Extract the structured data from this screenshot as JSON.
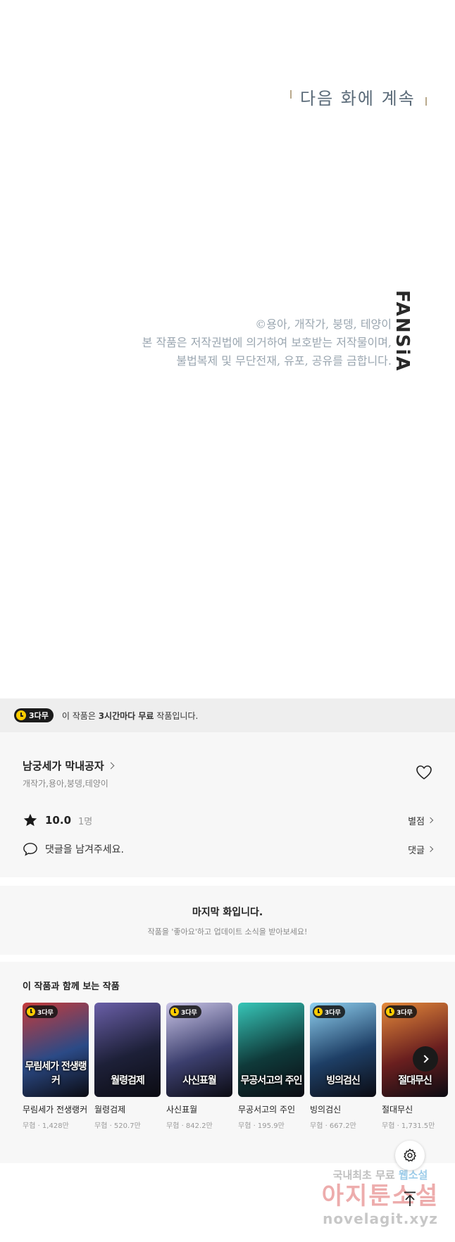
{
  "episode": {
    "to_be_continued": "다음 화에 계속",
    "copyright_lines": [
      "©용아, 개작가, 붕뎅, 테양이",
      "본 작품은 저작권법에 의거하여 보호받는 저작물이며,",
      "불법복제 및 무단전재, 유포, 공유를 금합니다."
    ],
    "logo": "FANSiA"
  },
  "free_banner": {
    "badge": "3다무",
    "message_prefix": "이 작품은 ",
    "message_bold": "3시간마다 무료",
    "message_suffix": " 작품입니다."
  },
  "work": {
    "title": "남궁세가 막내공자",
    "authors": "개작가,용아,붕뎅,테양이",
    "rating": "10.0",
    "rating_count": "1명",
    "rating_link": "별점",
    "comment_placeholder": "댓글을 남겨주세요.",
    "comment_link": "댓글"
  },
  "last_episode": {
    "title": "마지막 화입니다.",
    "subtitle": "작품을 '좋아요'하고 업데이트 소식을 받아보세요!"
  },
  "recommendations": {
    "title": "이 작품과 함께 보는 작품",
    "items": [
      {
        "badge": "3다무",
        "cover_text": "무림세가 전생랭커",
        "name": "무림세가 전생랭커",
        "meta": "무협 · 1,428만",
        "color1": "#2b4a86",
        "color2": "#c53a3a"
      },
      {
        "badge": "",
        "cover_text": "월령검제",
        "name": "월령검제",
        "meta": "무협 · 520.7만",
        "color1": "#1d2038",
        "color2": "#6a5fa8"
      },
      {
        "badge": "3다무",
        "cover_text": "사신표월",
        "name": "사신표월",
        "meta": "무협 · 842.2만",
        "color1": "#3c3f6e",
        "color2": "#c9c4e6"
      },
      {
        "badge": "",
        "cover_text": "무공서고의 주인",
        "name": "무공서고의 주인",
        "meta": "무협 · 195.9만",
        "color1": "#0f3a3a",
        "color2": "#37c6b8"
      },
      {
        "badge": "3다무",
        "cover_text": "빙의검신",
        "name": "빙의검신",
        "meta": "무협 · 667.2만",
        "color1": "#1e3f66",
        "color2": "#8fd0f0"
      },
      {
        "badge": "3다무",
        "cover_text": "절대무신",
        "name": "절대무신",
        "meta": "무협 · 1,731.5만",
        "color1": "#6a1f1f",
        "color2": "#e58a3a"
      }
    ]
  },
  "watermark": {
    "line1_a": "국내최초 무료",
    "line1_b": "웹소설",
    "line2": "아지툰소설",
    "line3": "novelagit.xyz"
  }
}
